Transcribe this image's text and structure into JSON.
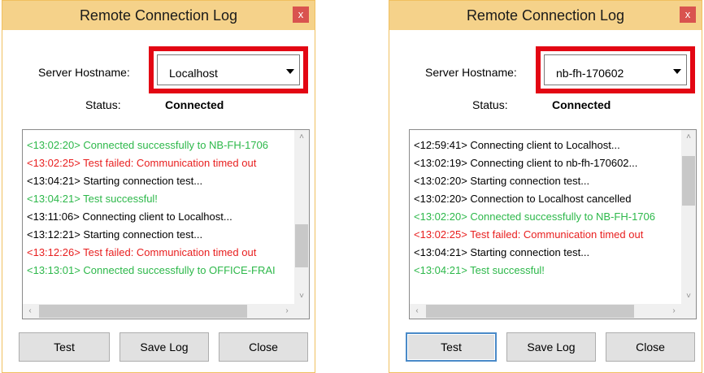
{
  "dialogs": [
    {
      "title": "Remote Connection Log",
      "close_glyph": "x",
      "host_label": "Server Hostname:",
      "host_value": "Localhost",
      "status_label": "Status:",
      "status_value": "Connected",
      "vscroll_thumb_fraction": [
        0.55,
        0.85
      ],
      "log": [
        {
          "text": "<13:02:20> Connected successfully to NB-FH-1706",
          "color": "green"
        },
        {
          "text": "<13:02:25> Test failed: Communication timed out",
          "color": "red"
        },
        {
          "text": "<13:04:21> Starting connection test...",
          "color": "black"
        },
        {
          "text": "<13:04:21> Test successful!",
          "color": "green"
        },
        {
          "text": "<13:11:06> Connecting client to Localhost...",
          "color": "black"
        },
        {
          "text": "<13:12:21> Starting connection test...",
          "color": "black"
        },
        {
          "text": "<13:12:26> Test failed: Communication timed out",
          "color": "red"
        },
        {
          "text": "<13:13:01> Connected successfully to OFFICE-FRAI",
          "color": "green"
        }
      ],
      "buttons": {
        "test": "Test",
        "save_log": "Save Log",
        "close": "Close"
      },
      "focused_button": ""
    },
    {
      "title": "Remote Connection Log",
      "close_glyph": "x",
      "host_label": "Server Hostname:",
      "host_value": "nb-fh-170602",
      "status_label": "Status:",
      "status_value": "Connected",
      "vscroll_thumb_fraction": [
        0.08,
        0.42
      ],
      "log": [
        {
          "text": "<12:59:41> Connecting client to Localhost...",
          "color": "black"
        },
        {
          "text": "<13:02:19> Connecting client to nb-fh-170602...",
          "color": "black"
        },
        {
          "text": "<13:02:20> Starting connection test...",
          "color": "black"
        },
        {
          "text": "<13:02:20> Connection to Localhost cancelled",
          "color": "black"
        },
        {
          "text": "<13:02:20> Connected successfully to NB-FH-1706",
          "color": "green"
        },
        {
          "text": "<13:02:25> Test failed: Communication timed out",
          "color": "red"
        },
        {
          "text": "<13:04:21> Starting connection test...",
          "color": "black"
        },
        {
          "text": "<13:04:21> Test successful!",
          "color": "green"
        }
      ],
      "buttons": {
        "test": "Test",
        "save_log": "Save Log",
        "close": "Close"
      },
      "focused_button": "test"
    }
  ],
  "colors": {
    "titlebar": "#f5d28a",
    "highlight_box": "#e30613",
    "log_green": "#2db84a",
    "log_red": "#e81f1f",
    "close_button": "#d9534f",
    "focus_border": "#4a8ac8"
  },
  "icons": {
    "dropdown": "chevron-down-icon",
    "scroll_up": "chevron-up-icon",
    "scroll_down": "chevron-down-icon",
    "scroll_left": "chevron-left-icon",
    "scroll_right": "chevron-right-icon"
  }
}
